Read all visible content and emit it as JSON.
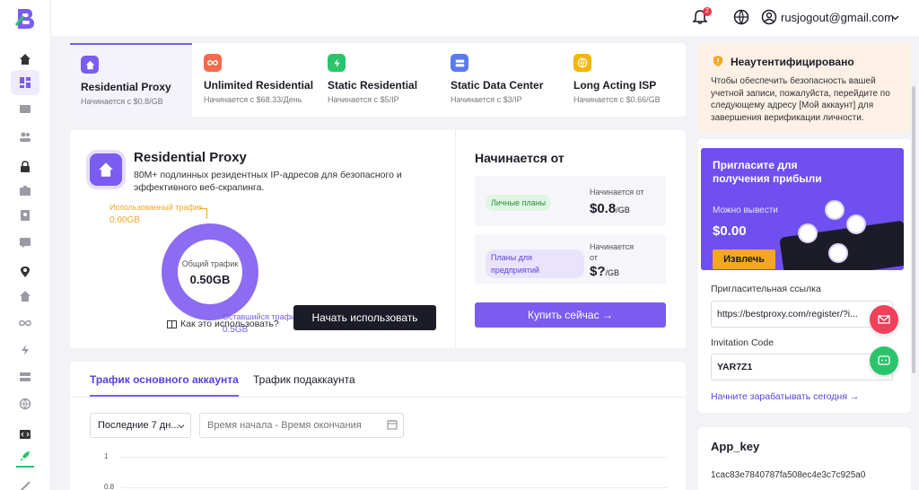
{
  "topbar": {
    "notification_count": "2",
    "user_email": "rusjogout@gmail.com"
  },
  "products": [
    {
      "title": "Residential Proxy",
      "sub": "Начинается с $0.8/GB",
      "icon": "home-icon",
      "color": "#7b5cf0"
    },
    {
      "title": "Unlimited Residential",
      "sub": "Начинается с $68.33/День",
      "icon": "infinity-icon",
      "color": "#f26b4b"
    },
    {
      "title": "Static Residential",
      "sub": "Начинается с $5/IP",
      "icon": "bolt-icon",
      "color": "#2bc46b"
    },
    {
      "title": "Static Data Center",
      "sub": "Начинается с $3/IP",
      "icon": "server-icon",
      "color": "#5b7bf0"
    },
    {
      "title": "Long Acting ISP",
      "sub": "Начинается с $0.66/GB",
      "icon": "globe-icon",
      "color": "#f5b400"
    }
  ],
  "main": {
    "title": "Residential Proxy",
    "description": "80M+ подлинных резидентных IP-адресов для безопасного и эффективного веб-скрапинга.",
    "used_label": "Использованный трафик",
    "used_value": "0.00GB",
    "total_label": "Общий трафик",
    "total_value": "0.50GB",
    "remaining_label": "Оставшийся трафик",
    "remaining_value": "0.5GB",
    "howto": "Как это использовать?",
    "start_button": "Начать использовать"
  },
  "pricing": {
    "title": "Начинается от",
    "personal_tag": "Личные планы",
    "personal_start": "Начинается от",
    "personal_price": "$0.8",
    "personal_unit": "/GB",
    "enterprise_tag": "Планы для предприятий",
    "enterprise_start": "Начинается от",
    "enterprise_price": "$?",
    "enterprise_unit": "/GB",
    "buy_button": "Купить сейчас →"
  },
  "traffic": {
    "tab_main": "Трафик основного аккаунта",
    "tab_sub": "Трафик подаккаунта",
    "range_select": "Последние 7 дн...",
    "date_placeholder": "Время начала - Время окончания",
    "y_ticks": [
      "1",
      "0.8"
    ]
  },
  "auth": {
    "title": "Неаутентифицировано",
    "text": "Чтобы обеспечить безопасность вашей учетной записи, пожалуйста, перейдите по следующему адресу [Мой аккаунт] для завершения верификации личности."
  },
  "invite": {
    "banner_title": "Пригласите для получения прибыли",
    "withdraw_label": "Можно вывести",
    "withdraw_value": "$0.00",
    "withdraw_button": "Извлечь",
    "link_label": "Пригласительная ссылка",
    "link_value": "https://bestproxy.com/register/?i...",
    "code_label": "Invitation Code",
    "code_value": "YAR7Z1",
    "earn_link": "Начните зарабатывать сегодня →"
  },
  "appkey": {
    "title": "App_key",
    "value": "1cac83e7840787fa508ec4e3c7c925a0"
  },
  "colors": {
    "accent": "#7b5cf0",
    "dark": "#1c1c28",
    "warning": "#f5a623"
  }
}
